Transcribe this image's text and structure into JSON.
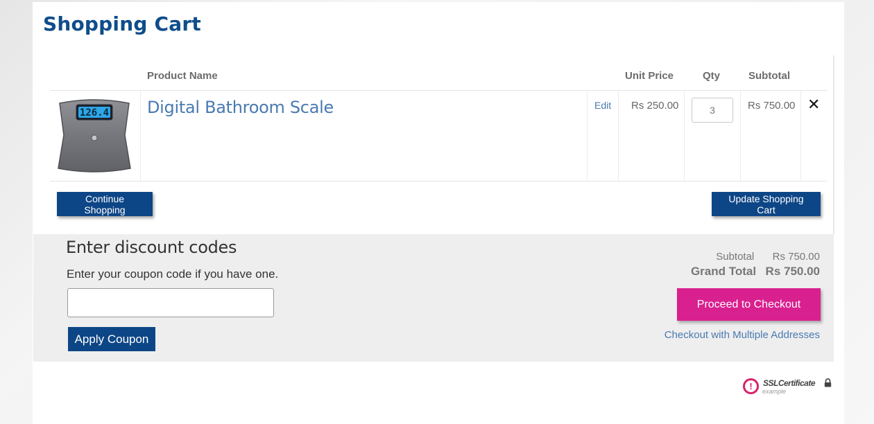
{
  "page": {
    "title": "Shopping Cart"
  },
  "table": {
    "headers": {
      "product_name": "Product Name",
      "unit_price": "Unit Price",
      "qty": "Qty",
      "subtotal": "Subtotal"
    },
    "items": [
      {
        "name": "Digital Bathroom Scale",
        "edit_label": "Edit",
        "unit_price": "Rs 250.00",
        "qty": "3",
        "subtotal": "Rs 750.00",
        "scale_display": "126.4"
      }
    ]
  },
  "actions": {
    "continue_label": "Continue Shopping",
    "update_label": "Update Shopping Cart"
  },
  "discount": {
    "title": "Enter discount codes",
    "description": "Enter your coupon code if you have one.",
    "input_value": "",
    "apply_label": "Apply Coupon"
  },
  "totals": {
    "subtotal_label": "Subtotal",
    "subtotal_value": "Rs 750.00",
    "grand_total_label": "Grand Total",
    "grand_total_value": "Rs 750.00",
    "checkout_label": "Proceed to Checkout",
    "multi_address_label": "Checkout with Multiple Addresses"
  },
  "ssl": {
    "mark": "!",
    "title": "SSLCertificate",
    "subtitle": "example"
  },
  "colors": {
    "brand_blue": "#0d4686",
    "title_blue": "#0f4d8a",
    "link_blue": "#4a7ab0",
    "checkout_pink": "#d9208f",
    "ssl_red": "#d9206a"
  }
}
